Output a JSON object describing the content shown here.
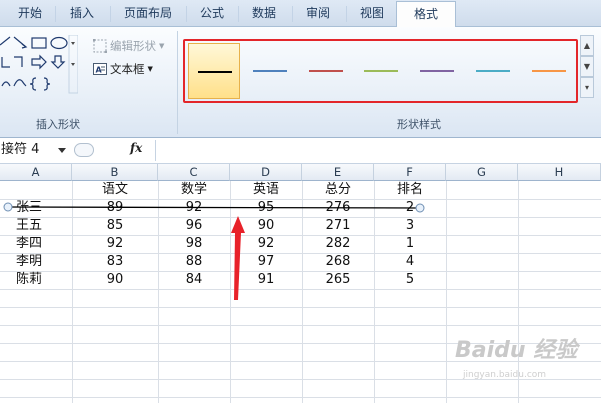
{
  "ribbon": {
    "tabs": [
      "开始",
      "插入",
      "页面布局",
      "公式",
      "数据",
      "审阅",
      "视图",
      "格式"
    ],
    "active_tab": "格式",
    "groups": {
      "insert_shapes_label": "插入形状",
      "shape_styles_label": "形状样式"
    },
    "commands": {
      "edit_shape": "编辑形状",
      "text_box": "文本框"
    },
    "line_styles": [
      {
        "color": "#000000",
        "selected": true
      },
      {
        "color": "#4f81bd"
      },
      {
        "color": "#c0504d"
      },
      {
        "color": "#9bbb59"
      },
      {
        "color": "#8064a2"
      },
      {
        "color": "#4bacc6"
      },
      {
        "color": "#f79646"
      }
    ]
  },
  "formula_bar": {
    "name_box": "接符 4",
    "fx_label": "fx",
    "formula": ""
  },
  "sheet": {
    "columns": [
      "A",
      "B",
      "C",
      "D",
      "E",
      "F",
      "G",
      "H"
    ],
    "header_row": [
      "",
      "语文",
      "数学",
      "英语",
      "总分",
      "排名"
    ],
    "rows": [
      [
        "张三",
        "89",
        "92",
        "95",
        "276",
        "2"
      ],
      [
        "王五",
        "85",
        "96",
        "90",
        "271",
        "3"
      ],
      [
        "李四",
        "92",
        "98",
        "92",
        "282",
        "1"
      ],
      [
        "李明",
        "83",
        "88",
        "97",
        "268",
        "4"
      ],
      [
        "陈莉",
        "90",
        "84",
        "91",
        "265",
        "5"
      ]
    ]
  },
  "watermark": {
    "text": "Baidu 经验",
    "sub": "jingyan.baidu.com"
  }
}
